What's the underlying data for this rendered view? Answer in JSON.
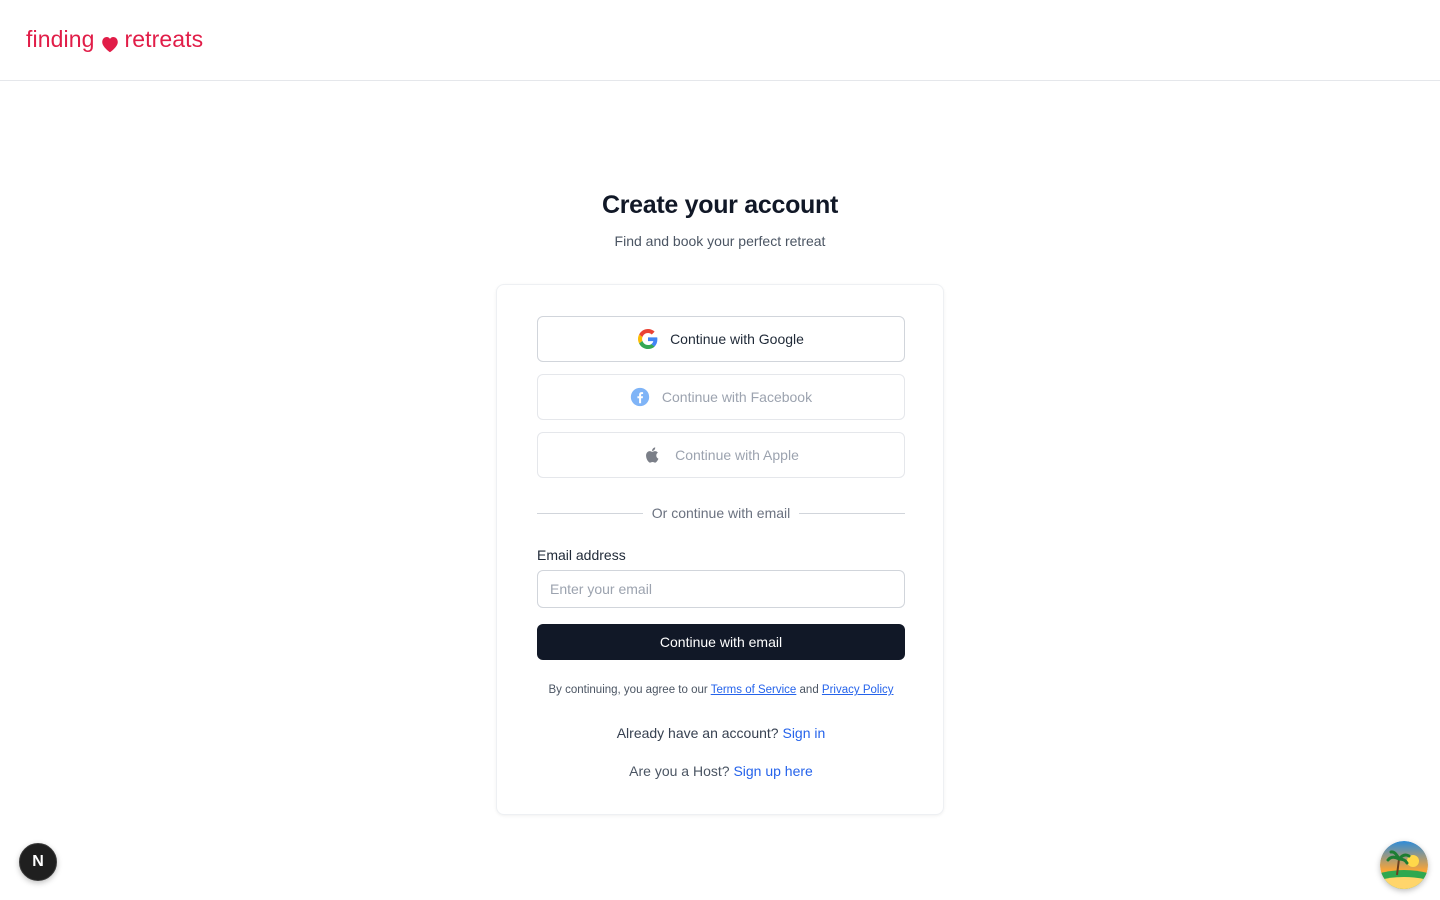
{
  "header": {
    "logo_left": "finding",
    "logo_right": "retreats",
    "brand_color": "#e11d48"
  },
  "main": {
    "title": "Create your account",
    "subtitle": "Find and book your perfect retreat"
  },
  "oauth": {
    "google_label": "Continue with Google",
    "facebook_label": "Continue with Facebook",
    "apple_label": "Continue with Apple"
  },
  "divider_text": "Or continue with email",
  "email": {
    "label": "Email address",
    "placeholder": "Enter your email",
    "value": "",
    "submit_label": "Continue with email"
  },
  "legal": {
    "prefix": "By continuing, you agree to our",
    "terms": "Terms of Service",
    "and": "and",
    "privacy": "Privacy Policy"
  },
  "footer": {
    "signin_prompt": "Already have an account?",
    "signin_link": "Sign in",
    "host_prompt": "Are you a Host?",
    "host_link": "Sign up here"
  },
  "badges": {
    "dev_badge_letter": "N"
  },
  "icons": {
    "logo": "heart-icon",
    "google": "google-icon",
    "facebook": "facebook-icon",
    "apple": "apple-icon",
    "dev": "nextjs-icon",
    "avatar": "beach-island-icon"
  }
}
